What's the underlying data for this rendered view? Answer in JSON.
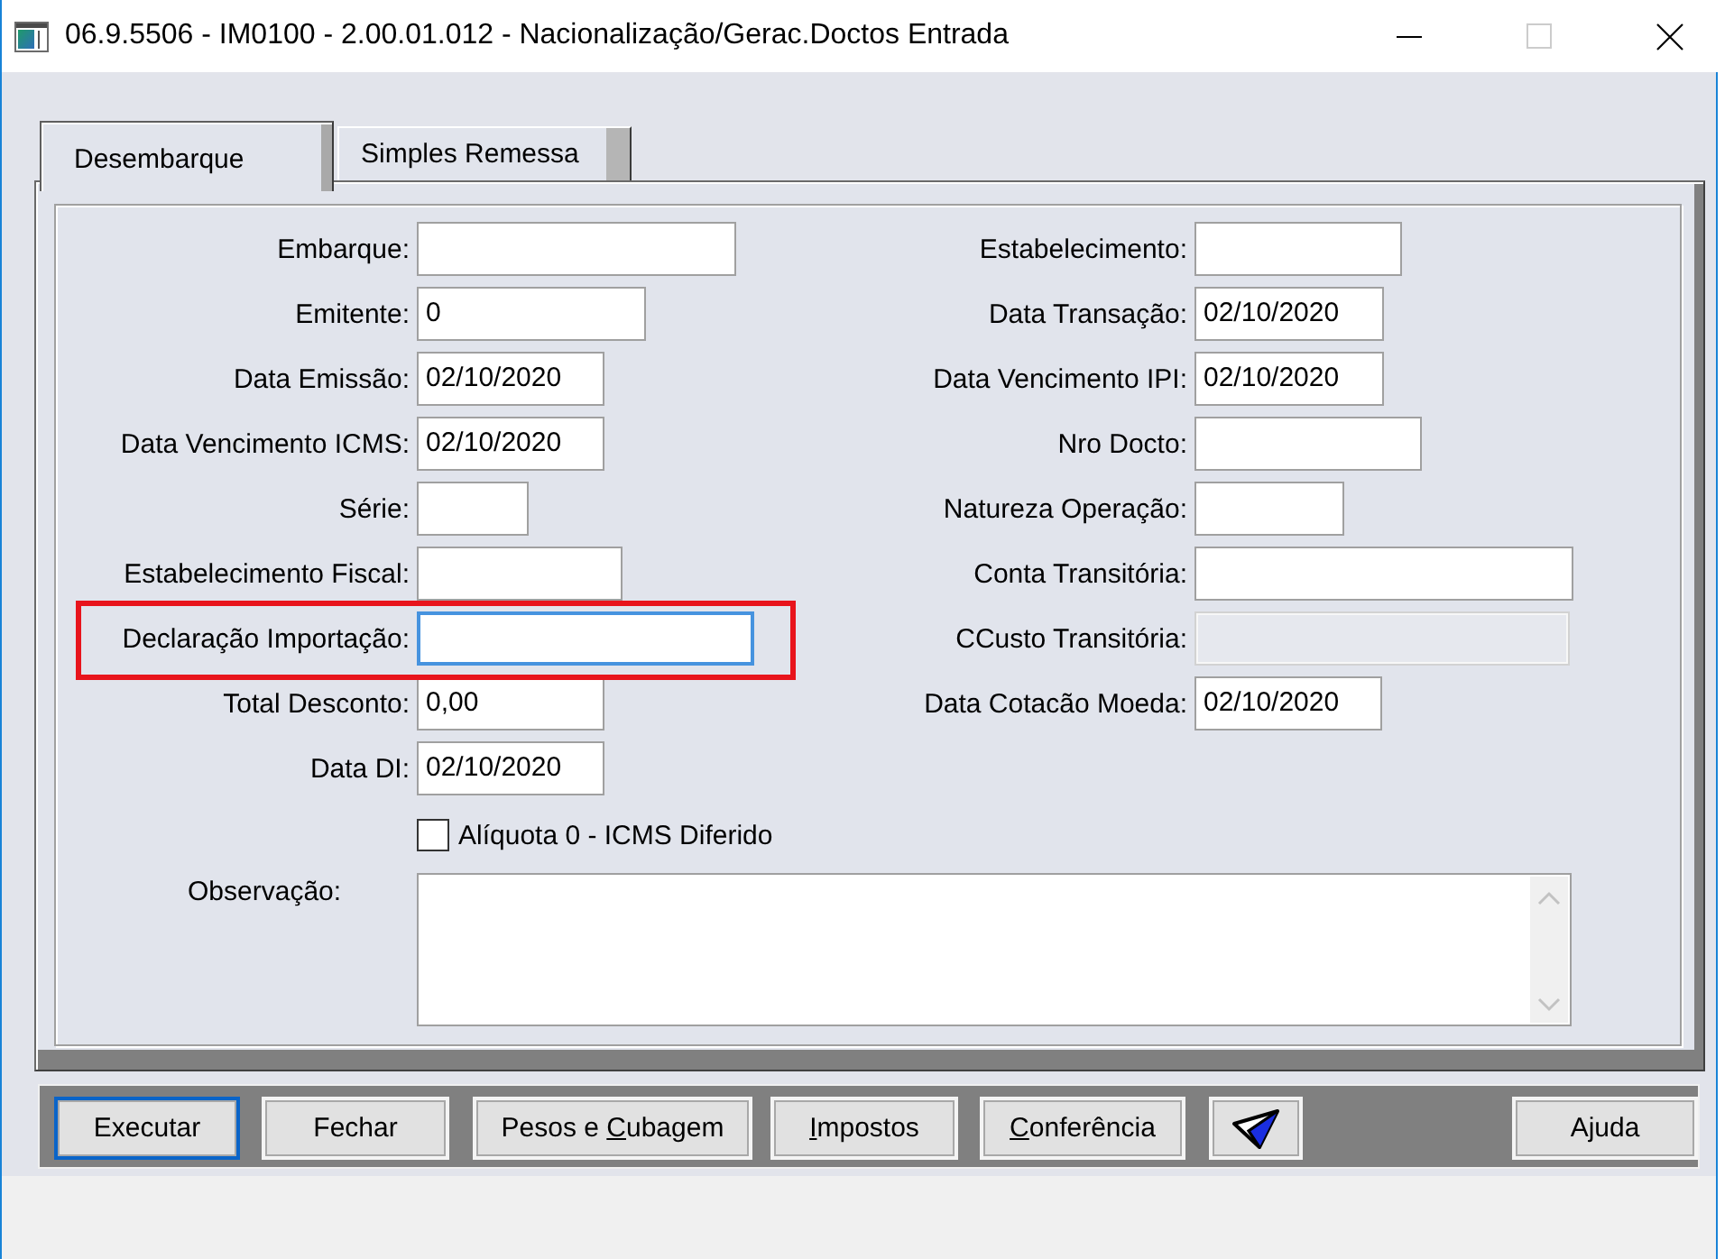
{
  "window": {
    "title": "06.9.5506 - IM0100 - 2.00.01.012 - Nacionalização/Gerac.Doctos Entrada",
    "maximize_disabled": true
  },
  "tabs": [
    {
      "label": "Desembarque",
      "selected": true
    },
    {
      "label": "Simples Remessa",
      "selected": false
    }
  ],
  "form": {
    "left_fields": [
      {
        "label": "Embarque:",
        "focused": false,
        "disabled": false,
        "highlighted": false
      },
      {
        "label": "Emitente:",
        "value": "0",
        "focused": false,
        "disabled": false,
        "highlighted": false
      },
      {
        "label": "Data Emissão:",
        "value": "02/10/2020",
        "focused": false,
        "disabled": false,
        "highlighted": false
      },
      {
        "label": "Data Vencimento ICMS:",
        "value": "02/10/2020",
        "focused": false,
        "disabled": false,
        "highlighted": false
      },
      {
        "label": "Série:",
        "focused": false,
        "disabled": false,
        "highlighted": false
      },
      {
        "label": "Estabelecimento Fiscal:",
        "focused": false,
        "disabled": false,
        "highlighted": false
      },
      {
        "label": "Declaração Importação:",
        "focused": true,
        "disabled": false,
        "highlighted": true
      },
      {
        "label": "Total Desconto:",
        "value": "0,00",
        "focused": false,
        "disabled": false,
        "highlighted": false
      },
      {
        "label": "Data DI:",
        "value": "02/10/2020",
        "focused": false,
        "disabled": false,
        "highlighted": false
      }
    ],
    "right_fields": [
      {
        "label": "Estabelecimento:",
        "focused": false,
        "disabled": false,
        "highlighted": false
      },
      {
        "label": "Data Transação:",
        "value": "02/10/2020",
        "focused": false,
        "disabled": false,
        "highlighted": false
      },
      {
        "label": "Data Vencimento IPI:",
        "value": "02/10/2020",
        "focused": false,
        "disabled": false,
        "highlighted": false
      },
      {
        "label": "Nro Docto:",
        "focused": false,
        "disabled": false,
        "highlighted": false
      },
      {
        "label": "Natureza Operação:",
        "focused": false,
        "disabled": false,
        "highlighted": false
      },
      {
        "label": "Conta Transitória:",
        "focused": false,
        "disabled": false,
        "highlighted": false
      },
      {
        "label": "CCusto Transitória:",
        "focused": false,
        "disabled": true,
        "highlighted": false
      },
      {
        "label": "Data Cotacão Moeda:",
        "value": "02/10/2020",
        "focused": false,
        "disabled": false,
        "highlighted": false
      }
    ],
    "checkbox": {
      "label": "Alíquota 0 - ICMS Diferido",
      "checked": false
    },
    "notes": {
      "label": "Observação:"
    }
  },
  "buttons": [
    {
      "kind": "text",
      "label": "Executar",
      "focused": true,
      "access_key_underlined": false
    },
    {
      "kind": "text",
      "label": "Fechar",
      "focused": false,
      "access_key_underlined": false
    },
    {
      "kind": "text",
      "label": "Pesos e Cubagem",
      "focused": false,
      "access_key_underlined": true
    },
    {
      "kind": "text",
      "label": "Impostos",
      "focused": false,
      "access_key_underlined": true
    },
    {
      "kind": "text",
      "label": "Conferência",
      "focused": false,
      "access_key_underlined": true
    },
    {
      "kind": "icon",
      "focused": false
    },
    {
      "kind": "text",
      "label": "Ajuda",
      "focused": false,
      "access_key_underlined": false
    }
  ]
}
